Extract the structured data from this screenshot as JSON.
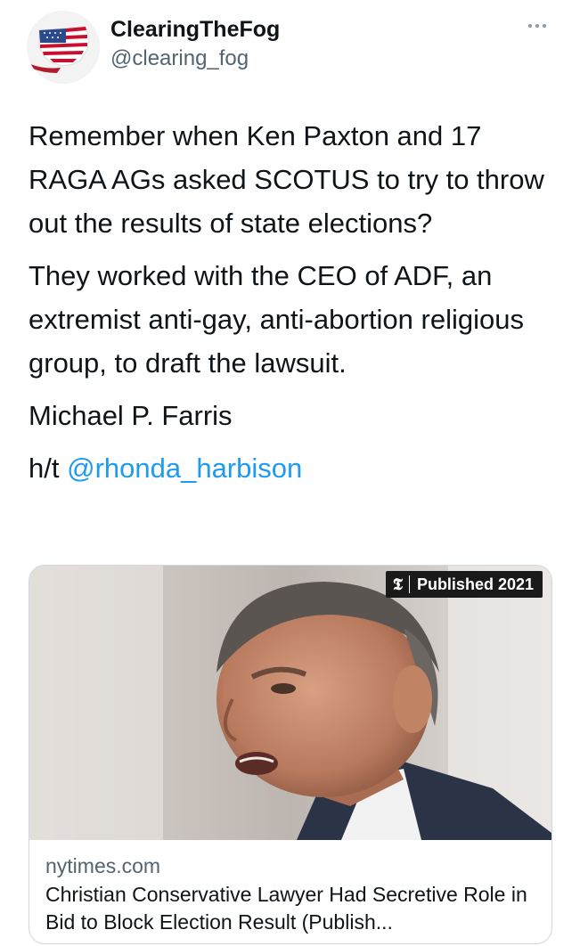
{
  "tweet": {
    "author": {
      "display_name": "ClearingTheFog",
      "handle": "@clearing_fog",
      "avatar_icon": "flag-map-avatar"
    },
    "more_icon": "more-dots-icon",
    "paragraphs": [
      "Remember when Ken Paxton and 17 RAGA AGs asked SCOTUS to try to throw out the results of state elections?",
      "They worked with the CEO of ADF, an extremist anti-gay, anti-abortion religious group, to draft the lawsuit.",
      "Michael P. Farris"
    ],
    "hat_tip": {
      "prefix": "h/t",
      "mention": "@rhonda_harbison"
    }
  },
  "link_card": {
    "badge_logo": "𝕿",
    "badge_text": "Published 2021",
    "domain": "nytimes.com",
    "title": "Christian Conservative Lawyer Had Secretive Role in Bid to Block Election Result (Publish..."
  },
  "colors": {
    "mention": "#1d9bf0",
    "secondary_text": "#536471",
    "primary_text": "#0f1419",
    "card_border": "#cfd9de"
  }
}
